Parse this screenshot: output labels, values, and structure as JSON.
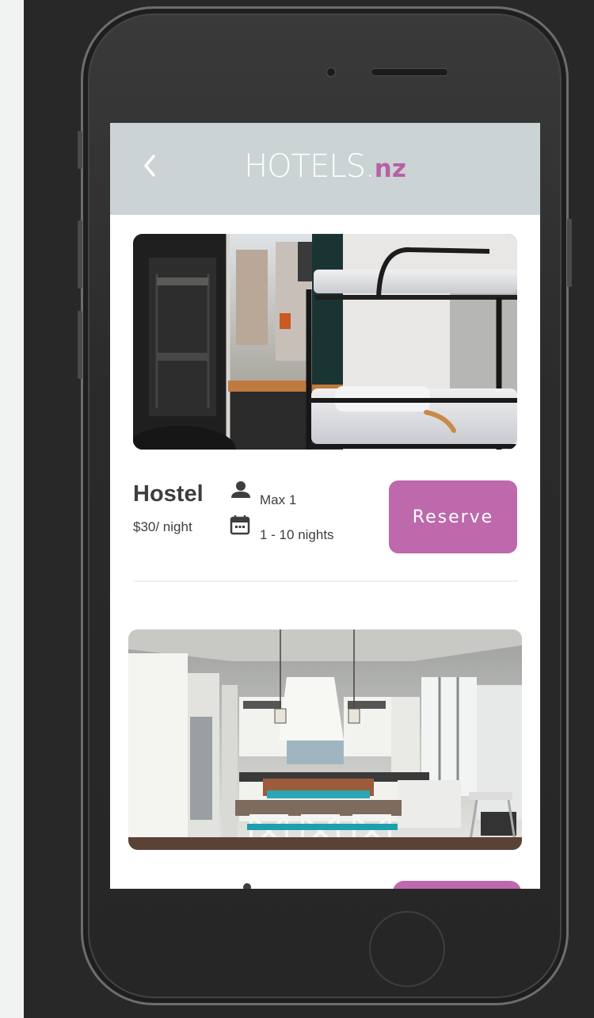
{
  "app": {
    "logo_main": "HOTELS.",
    "logo_suffix": "nz"
  },
  "colors": {
    "accent": "#bd69ac",
    "header_bg": "#ccd3d5",
    "text": "#3e3e3e"
  },
  "listings": [
    {
      "title": "Hostel",
      "price": "$30/ night",
      "guests": "Max 1",
      "nights": "1 - 10 nights",
      "reserve_label": "Reserve",
      "image": "bunk-bed-hostel-room-photo"
    },
    {
      "image": "kitchen-interior-photo",
      "reserve_label": ""
    }
  ],
  "icons": {
    "back": "chevron-left-icon",
    "guests": "person-icon",
    "nights": "calendar-icon"
  }
}
